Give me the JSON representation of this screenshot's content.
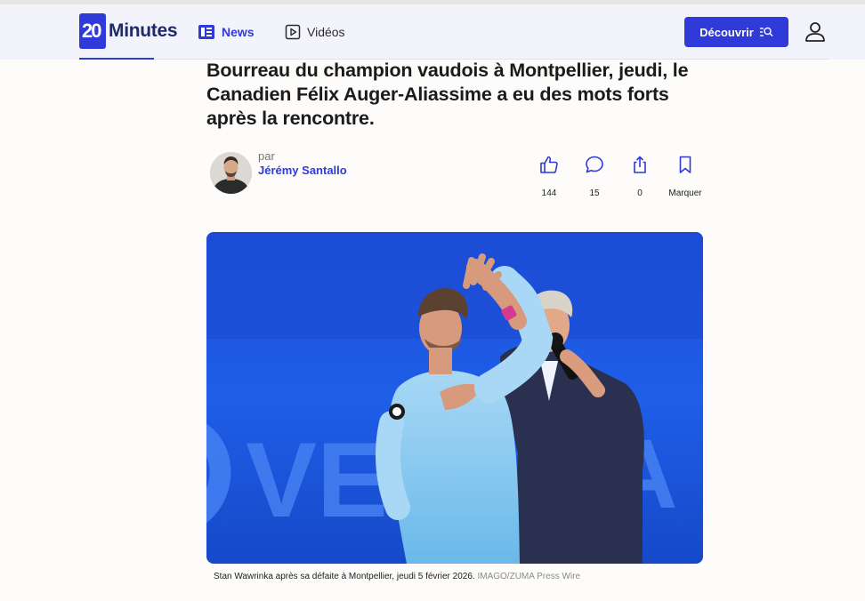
{
  "header": {
    "logo_mark": "20",
    "logo_text": "Minutes",
    "nav": [
      {
        "label": "News",
        "icon": "newspaper-icon",
        "active": true
      },
      {
        "label": "Vidéos",
        "icon": "play-icon",
        "active": false
      }
    ],
    "discover_label": "Découvrir",
    "accent_color": "#2f3ad8"
  },
  "article": {
    "headline": "Bourreau du champion vaudois à Montpellier, jeudi, le Canadien Félix Auger-Aliassime a eu des mots forts après la rencontre.",
    "byline_prefix": "par",
    "author": "Jérémy Santallo",
    "actions": [
      {
        "icon": "thumbs-up-icon",
        "count": "144"
      },
      {
        "icon": "comment-icon",
        "count": "15"
      },
      {
        "icon": "share-icon",
        "count": "0"
      },
      {
        "icon": "bookmark-icon",
        "count": "Marquer"
      }
    ],
    "photo_text": "VE",
    "photo_text_right": "A",
    "caption": "Stan Wawrinka après sa défaite à Montpellier, jeudi 5 février 2026.",
    "credit": "IMAGO/ZUMA Press Wire"
  }
}
